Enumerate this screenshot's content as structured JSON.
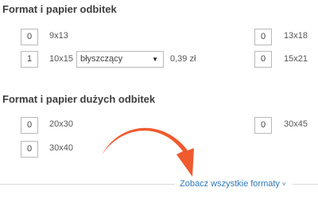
{
  "sections": {
    "small": {
      "title": "Format i papier odbitek",
      "formats": {
        "f9x13": {
          "qty": "0",
          "label": "9x13"
        },
        "f10x15": {
          "qty": "1",
          "label": "10x15"
        },
        "f13x18": {
          "qty": "0",
          "label": "13x18"
        },
        "f15x21": {
          "qty": "0",
          "label": "15x21"
        }
      },
      "paper_select": {
        "value": "błyszczący"
      },
      "price": "0,39 zł"
    },
    "large": {
      "title": "Format i papier dużych odbitek",
      "formats": {
        "f20x30": {
          "qty": "0",
          "label": "20x30"
        },
        "f30x40": {
          "qty": "0",
          "label": "30x40"
        },
        "f30x45": {
          "qty": "0",
          "label": "30x45"
        }
      }
    }
  },
  "footer": {
    "see_all_label": "Zobacz wszystkie formaty"
  },
  "icons": {
    "select_caret": "▼",
    "see_all_chevron": "˅"
  },
  "colors": {
    "arrow": "#ef5a2f",
    "link": "#2f78b8",
    "input_border": "#b9b9b9",
    "divider": "#d8d8d8"
  }
}
